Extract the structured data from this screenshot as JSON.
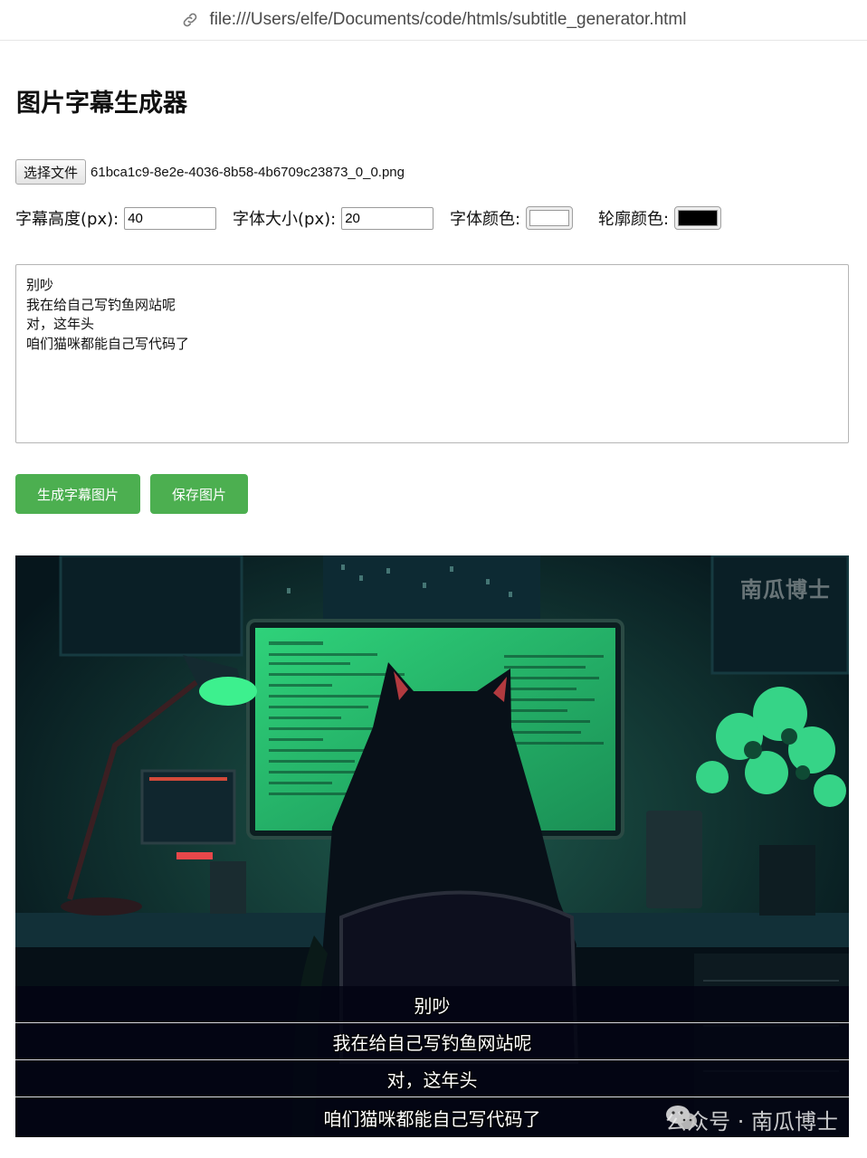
{
  "browser": {
    "url": "file:///Users/elfe/Documents/code/htmls/subtitle_generator.html"
  },
  "page": {
    "title": "图片字幕生成器"
  },
  "file_input": {
    "button_label": "选择文件",
    "file_name": "61bca1c9-8e2e-4036-8b58-4b6709c23873_0_0.png"
  },
  "controls": {
    "subtitle_height_label": "字幕高度(px):",
    "subtitle_height_value": "40",
    "font_size_label": "字体大小(px):",
    "font_size_value": "20",
    "font_color_label": "字体颜色:",
    "font_color_value": "#ffffff",
    "outline_color_label": "轮廓颜色:",
    "outline_color_value": "#000000"
  },
  "subtitle_text": "别吵\n我在给自己写钓鱼网站呢\n对，这年头\n咱们猫咪都能自己写代码了",
  "buttons": {
    "generate": "生成字幕图片",
    "save": "保存图片"
  },
  "preview": {
    "watermark_top": "南瓜博士",
    "watermark_bottom": "公众号 · 南瓜博士",
    "subtitles": [
      "别吵",
      "我在给自己写钓鱼网站呢",
      "对，这年头",
      "咱们猫咪都能自己写代码了"
    ],
    "accent_color": "#4caf50",
    "scene": "cat-coding-at-green-monitor"
  }
}
